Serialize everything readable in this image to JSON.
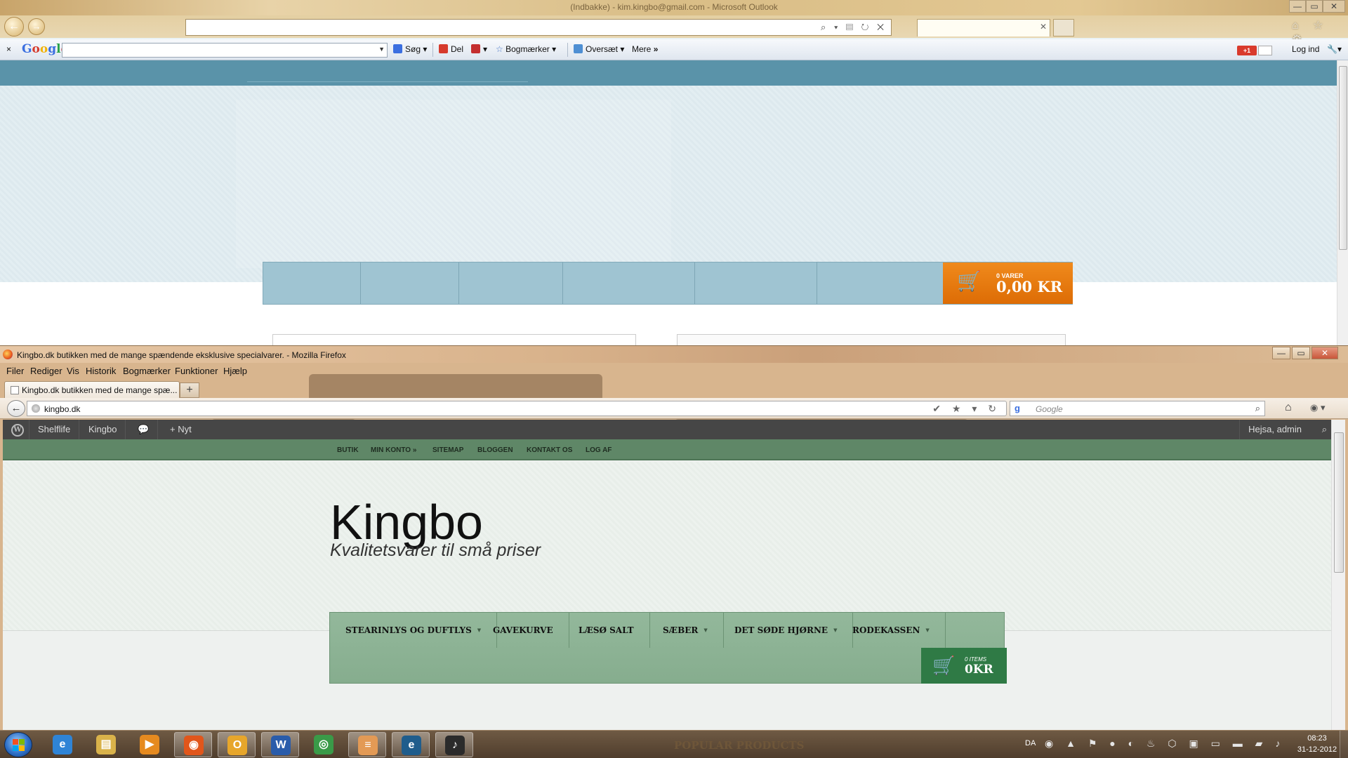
{
  "ie": {
    "title": "(Indbakke) - kim.kingbo@gmail.com - Microsoft Outlook",
    "nav": {
      "back_icon": "back-arrow-icon",
      "forward_icon": "forward-arrow-icon"
    },
    "address_icons": "⌕ ▾ ▤ ↻ ✕",
    "right_icons": "⌂ ☆ ⚙",
    "google_toolbar": {
      "close": "×",
      "search_btn": "Søg",
      "share_btn": "Del",
      "bookmarks_btn": "Bogmærker",
      "translate_btn": "Oversæt",
      "more_btn": "Mere",
      "more_glyph": "»",
      "plus1": "+1",
      "login": "Log ind",
      "wrench": "🔧"
    },
    "cart": {
      "count": "0 VARER",
      "total": "0,00 KR",
      "accent": "#e8780f"
    }
  },
  "ff": {
    "title": "Kingbo.dk butikken med de mange spændende eksklusive specialvarer. - Mozilla Firefox",
    "window_buttons": {
      "minimize": "—",
      "maximize": "▭",
      "close": "✕"
    },
    "menu": [
      "Filer",
      "Rediger",
      "Vis",
      "Historik",
      "Bogmærker",
      "Funktioner",
      "Hjælp"
    ],
    "tab_label": "Kingbo.dk butikken med de mange spæ...",
    "new_tab": "+",
    "back": "←",
    "url": "kingbo.dk",
    "url_icons": "✔ ★ ▾ ↻",
    "search_placeholder": "Google",
    "search_engine": "g",
    "home": "⌂",
    "admin_bar": {
      "logo": "W",
      "site1": "Shelflife",
      "site2": "Kingbo",
      "comments": "💬",
      "new": "+ Nyt",
      "greeting": "Hejsa, admin",
      "search_icon": "⌕"
    },
    "top_nav": [
      "BUTIK",
      "MIN KONTO »",
      "SITEMAP",
      "BLOGGEN",
      "KONTAKT OS",
      "LOG AF"
    ],
    "site_title": "Kingbo",
    "tagline": "Kvalitetsvarer til små priser",
    "categories": [
      {
        "label": "STEARINLYS OG DUFTLYS",
        "caret": true
      },
      {
        "label": "GAVEKURVE",
        "caret": false
      },
      {
        "label": "LÆSØ SALT",
        "caret": false
      },
      {
        "label": "SÆBER",
        "caret": true
      },
      {
        "label": "DET SØDE HJØRNE",
        "caret": true
      },
      {
        "label": "RODEKASSEN",
        "caret": true
      }
    ],
    "caret_glyph": "▼",
    "cart": {
      "count": "0 ITEMS",
      "total": "0KR",
      "accent": "#2f7a45"
    },
    "cart_icon": "🛒"
  },
  "taskbar": {
    "popular": "POPULAR PRODUCTS",
    "language": "DA",
    "tray_icons": "◉ ▲ ⚑ ● ◐ ♨ ⬡ ▣ ▭ ▬ ▰ ♪",
    "time": "08:23",
    "date": "31-12-2012",
    "apps": [
      {
        "name": "internet-explorer",
        "glyph": "e",
        "color": "#2f84d6"
      },
      {
        "name": "file-explorer",
        "glyph": "▤",
        "color": "#d9b24a"
      },
      {
        "name": "media-player",
        "glyph": "▶",
        "color": "#e68a1f"
      },
      {
        "name": "firefox",
        "glyph": "◉",
        "color": "#e1561b"
      },
      {
        "name": "outlook",
        "glyph": "O",
        "color": "#e7a62b"
      },
      {
        "name": "word",
        "glyph": "W",
        "color": "#2a5caa"
      },
      {
        "name": "chrome",
        "glyph": "◎",
        "color": "#3a9a48"
      },
      {
        "name": "notes",
        "glyph": "≡",
        "color": "#e39a55"
      },
      {
        "name": "ie-network",
        "glyph": "e",
        "color": "#1f5d8c"
      },
      {
        "name": "app-green",
        "glyph": "♪",
        "color": "#2b2b2b"
      }
    ]
  }
}
